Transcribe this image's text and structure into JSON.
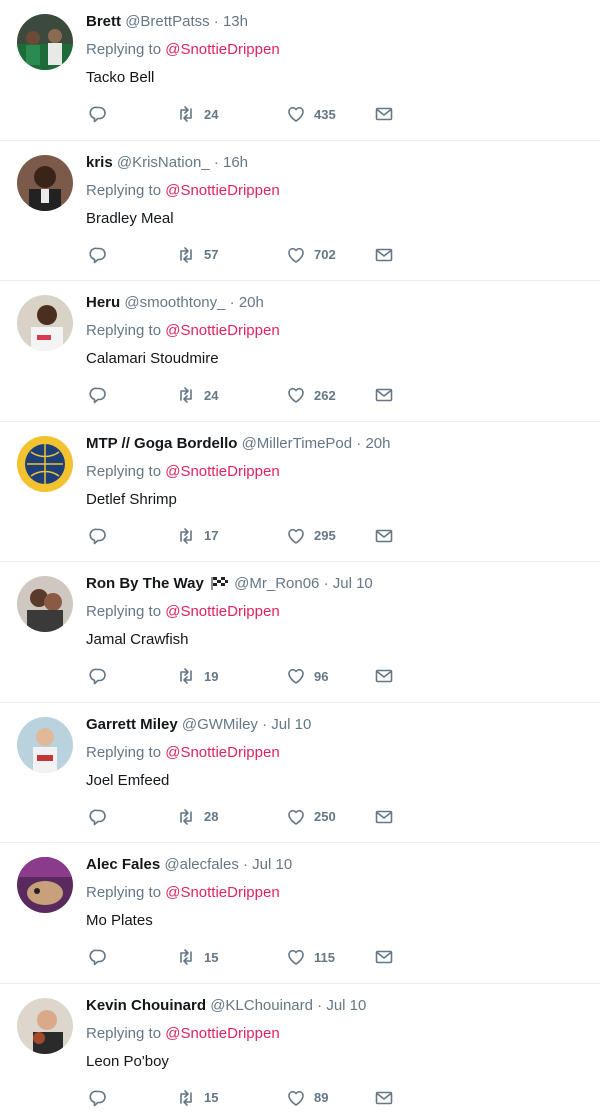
{
  "colors": {
    "mention": "#e0245e",
    "meta": "#657786",
    "text": "#14171a",
    "divider": "#e6ecf0"
  },
  "icons": {
    "reply": "reply-icon",
    "retweet": "retweet-icon",
    "like": "heart-icon",
    "dm": "envelope-icon",
    "flag": "checkered-flag-icon"
  },
  "replies": [
    {
      "name": "Brett",
      "handle": "@BrettPatss",
      "dot": "·",
      "time": "13h",
      "replying_prefix": "Replying to",
      "replying_to": "@SnottieDrippen",
      "text": "Tacko Bell",
      "retweets": "24",
      "likes": "435"
    },
    {
      "name": "kris",
      "handle": "@KrisNation_",
      "dot": "·",
      "time": "16h",
      "replying_prefix": "Replying to",
      "replying_to": "@SnottieDrippen",
      "text": "Bradley Meal",
      "retweets": "57",
      "likes": "702"
    },
    {
      "name": "Heru",
      "handle": "@smoothtony_",
      "dot": "·",
      "time": "20h",
      "replying_prefix": "Replying to",
      "replying_to": "@SnottieDrippen",
      "text": "Calamari Stoudmire",
      "retweets": "24",
      "likes": "262"
    },
    {
      "name": "MTP // Goga Bordello",
      "handle": "@MillerTimePod",
      "dot": "·",
      "time": "20h",
      "replying_prefix": "Replying to",
      "replying_to": "@SnottieDrippen",
      "text": "Detlef Shrimp",
      "retweets": "17",
      "likes": "295"
    },
    {
      "name": "Ron By The Way",
      "handle": "@Mr_Ron06",
      "dot": "·",
      "time": "Jul 10",
      "replying_prefix": "Replying to",
      "replying_to": "@SnottieDrippen",
      "text": "Jamal Crawfish",
      "retweets": "19",
      "likes": "96"
    },
    {
      "name": "Garrett Miley",
      "handle": "@GWMiley",
      "dot": "·",
      "time": "Jul 10",
      "replying_prefix": "Replying to",
      "replying_to": "@SnottieDrippen",
      "text": "Joel Emfeed",
      "retweets": "28",
      "likes": "250"
    },
    {
      "name": "Alec Fales",
      "handle": "@alecfales",
      "dot": "·",
      "time": "Jul 10",
      "replying_prefix": "Replying to",
      "replying_to": "@SnottieDrippen",
      "text": "Mo Plates",
      "retweets": "15",
      "likes": "115"
    },
    {
      "name": "Kevin Chouinard",
      "handle": "@KLChouinard",
      "dot": "·",
      "time": "Jul 10",
      "replying_prefix": "Replying to",
      "replying_to": "@SnottieDrippen",
      "text": "Leon Po'boy",
      "retweets": "15",
      "likes": "89"
    }
  ]
}
